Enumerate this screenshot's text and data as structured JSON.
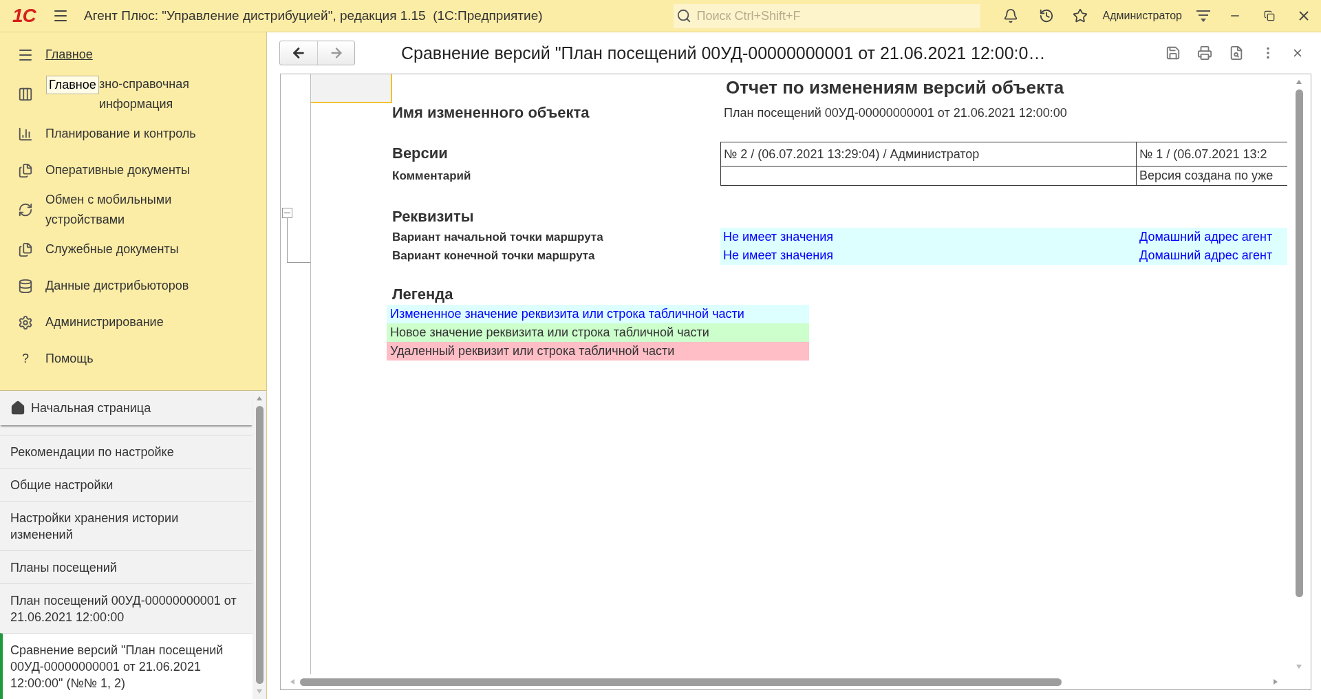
{
  "app_bar": {
    "logo": "1С",
    "title": "Агент Плюс: \"Управление дистрибуцией\", редакция 1.15  (1С:Предприятие)",
    "search": {
      "placeholder": "Поиск Ctrl+Shift+F"
    },
    "user": "Администратор"
  },
  "sidebar": {
    "main_link": "Главное",
    "tooltip": "Главное",
    "sections": [
      {
        "label": "зно-справочная информация"
      },
      {
        "label": "Планирование и контроль"
      },
      {
        "label": "Оперативные документы"
      },
      {
        "label": "Обмен с мобильными устройствами"
      },
      {
        "label": "Служебные документы"
      },
      {
        "label": "Данные дистрибьюторов"
      },
      {
        "label": "Администрирование"
      },
      {
        "label": "Помощь",
        "glyph": "?"
      }
    ]
  },
  "open_windows": {
    "home": "Начальная страница",
    "items": [
      {
        "label": "Рекомендации по настройке",
        "selected": false
      },
      {
        "label": "Общие настройки",
        "selected": false
      },
      {
        "label": "Настройки хранения истории изменений",
        "selected": false
      },
      {
        "label": "Планы посещений",
        "selected": false
      },
      {
        "label": "План посещений 00УД-00000000001 от 21.06.2021 12:00:00",
        "selected": false
      },
      {
        "label": "Сравнение версий \"План посещений 00УД-00000000001 от 21.06.2021 12:00:00\" (№№ 1, 2)",
        "selected": true
      }
    ]
  },
  "form": {
    "title": "Сравнение версий \"План посещений 00УД-00000000001 от 21.06.2021 12:00:0…"
  },
  "report": {
    "title": "Отчет по изменениям версий объекта",
    "object_label": "Имя измененного объекта",
    "object_value": "План посещений 00УД-00000000001 от 21.06.2021 12:00:00",
    "versions_label": "Версии",
    "comment_label": "Комментарий",
    "versions": [
      {
        "header": "№ 2 / (06.07.2021 13:29:04) / Администратор"
      },
      {
        "header": "№ 1 / (06.07.2021 13:2",
        "comment": "Версия создана по уже"
      }
    ],
    "attributes_label": "Реквизиты",
    "attributes": [
      {
        "name": "Вариант начальной точки маршрута",
        "kind": "changed",
        "values": [
          "Не имеет значения",
          "Домашний адрес агент"
        ]
      },
      {
        "name": "Вариант конечной точки маршрута",
        "kind": "changed",
        "values": [
          "Не имеет значения",
          "Домашний адрес агент"
        ]
      }
    ],
    "group_expanded": true,
    "legend_label": "Легенда",
    "legend": [
      {
        "text": "Измененное значение реквизита или строка табличной части",
        "kind": "changed"
      },
      {
        "text": "Новое значение реквизита или строка табличной части",
        "kind": "added"
      },
      {
        "text": "Удаленный реквизит или строка табличной части",
        "kind": "deleted"
      }
    ]
  }
}
